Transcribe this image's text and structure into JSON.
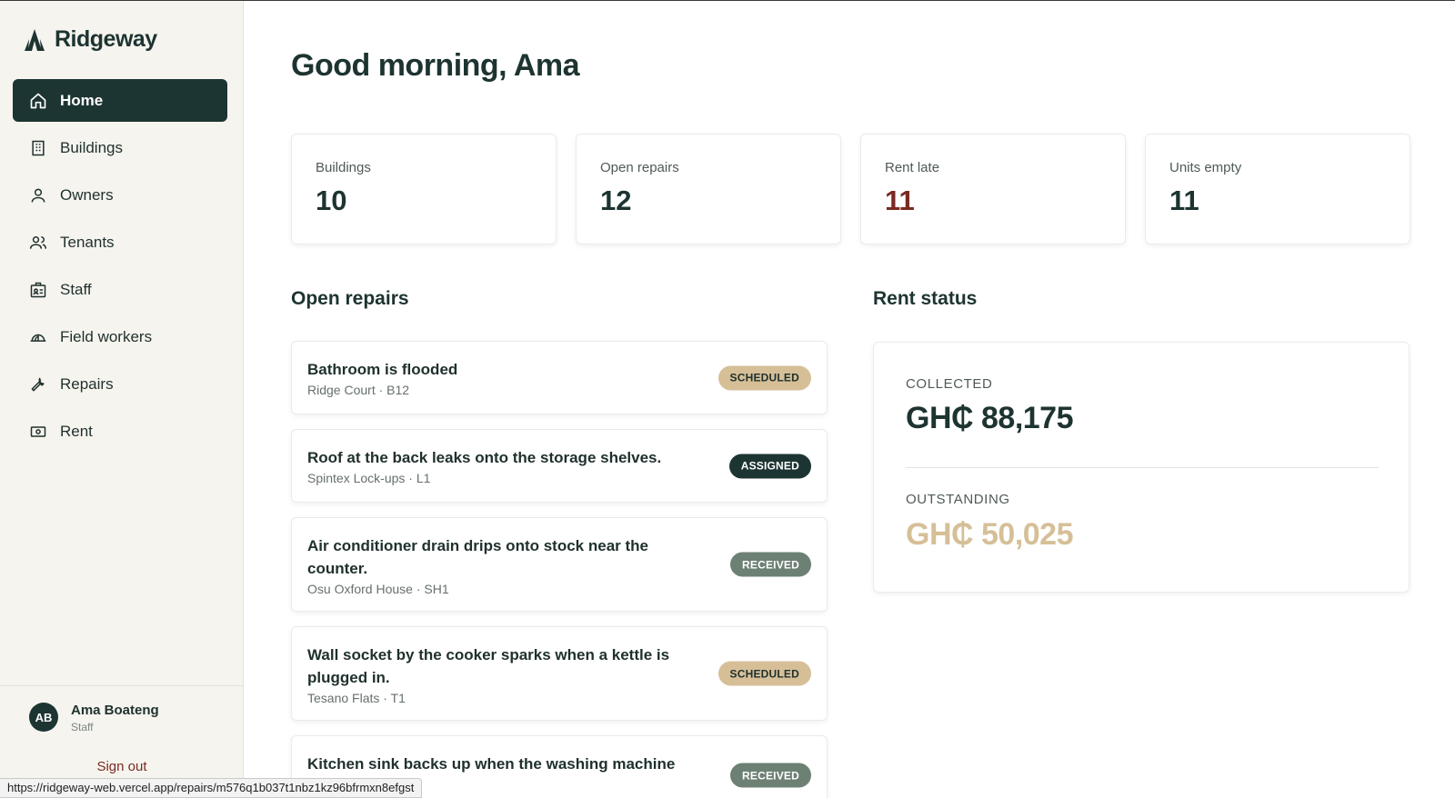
{
  "brand": {
    "name": "Ridgeway"
  },
  "sidebar": {
    "items": [
      {
        "label": "Home",
        "icon": "home-icon",
        "active": true
      },
      {
        "label": "Buildings",
        "icon": "building-icon"
      },
      {
        "label": "Owners",
        "icon": "user-icon"
      },
      {
        "label": "Tenants",
        "icon": "users-icon"
      },
      {
        "label": "Staff",
        "icon": "id-badge-icon"
      },
      {
        "label": "Field workers",
        "icon": "helmet-icon"
      },
      {
        "label": "Repairs",
        "icon": "wrench-icon"
      },
      {
        "label": "Rent",
        "icon": "banknote-icon"
      }
    ]
  },
  "user": {
    "initials": "AB",
    "name": "Ama Boateng",
    "role": "Staff",
    "sign_out": "Sign out"
  },
  "status_bar": {
    "url": "https://ridgeway-web.vercel.app/repairs/m576q1b037t1nbz1kz96bfrmxn8efgst"
  },
  "main": {
    "greeting": "Good morning, Ama",
    "stats": [
      {
        "label": "Buildings",
        "value": "10"
      },
      {
        "label": "Open repairs",
        "value": "12"
      },
      {
        "label": "Rent late",
        "value": "11"
      },
      {
        "label": "Units empty",
        "value": "11"
      }
    ],
    "repairs_title": "Open repairs",
    "repairs": [
      {
        "title": "Bathroom is flooded",
        "location": "Ridge Court · B12",
        "status": "SCHEDULED"
      },
      {
        "title": "Roof at the back leaks onto the storage shelves.",
        "location": "Spintex Lock-ups · L1",
        "status": "ASSIGNED"
      },
      {
        "title": "Air conditioner drain drips onto stock near the counter.",
        "location": "Osu Oxford House · SH1",
        "status": "RECEIVED"
      },
      {
        "title": "Wall socket by the cooker sparks when a kettle is plugged in.",
        "location": "Tesano Flats · T1",
        "status": "SCHEDULED"
      },
      {
        "title": "Kitchen sink backs up when the washing machine drains.",
        "location": "",
        "status": "RECEIVED"
      }
    ],
    "rent_title": "Rent status",
    "rent": {
      "collected_label": "COLLECTED",
      "collected_value": "GH₵ 88,175",
      "outstanding_label": "OUTSTANDING",
      "outstanding_value": "GH₵ 50,025"
    }
  },
  "colors": {
    "brand_dark": "#1d3532",
    "late_red": "#7a2a22",
    "outstanding_tan": "#d6bf97",
    "received_green": "#6d8074"
  }
}
